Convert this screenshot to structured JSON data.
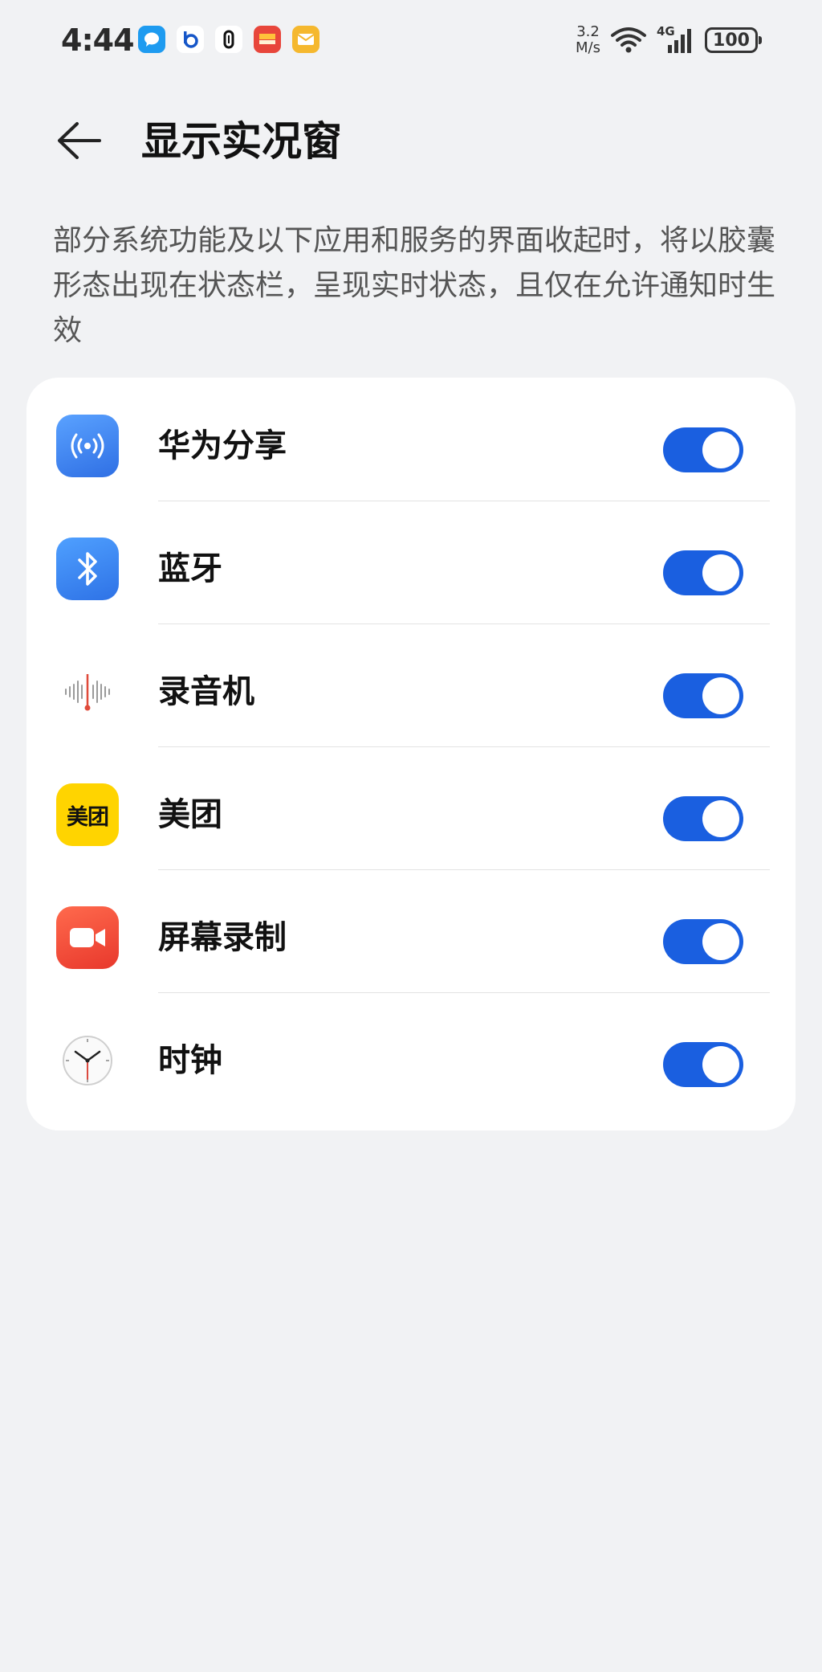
{
  "status_bar": {
    "time": "4:44",
    "net_speed_value": "3.2",
    "net_speed_unit": "M/s",
    "network_type": "4G",
    "battery": "100"
  },
  "header": {
    "title": "显示实况窗"
  },
  "description": "部分系统功能及以下应用和服务的界面收起时，将以胶囊形态出现在状态栏，呈现实时状态，且仅在允许通知时生效",
  "items": [
    {
      "label": "华为分享",
      "icon": "huawei-share-icon",
      "enabled": true
    },
    {
      "label": "蓝牙",
      "icon": "bluetooth-icon",
      "enabled": true
    },
    {
      "label": "录音机",
      "icon": "recorder-icon",
      "enabled": true
    },
    {
      "label": "美团",
      "icon": "meituan-icon",
      "icon_text": "美团",
      "enabled": true
    },
    {
      "label": "屏幕录制",
      "icon": "screen-record-icon",
      "enabled": true
    },
    {
      "label": "时钟",
      "icon": "clock-icon",
      "enabled": true
    }
  ],
  "colors": {
    "background": "#f1f2f4",
    "toggle_on": "#1a5fe0",
    "card": "#ffffff"
  }
}
